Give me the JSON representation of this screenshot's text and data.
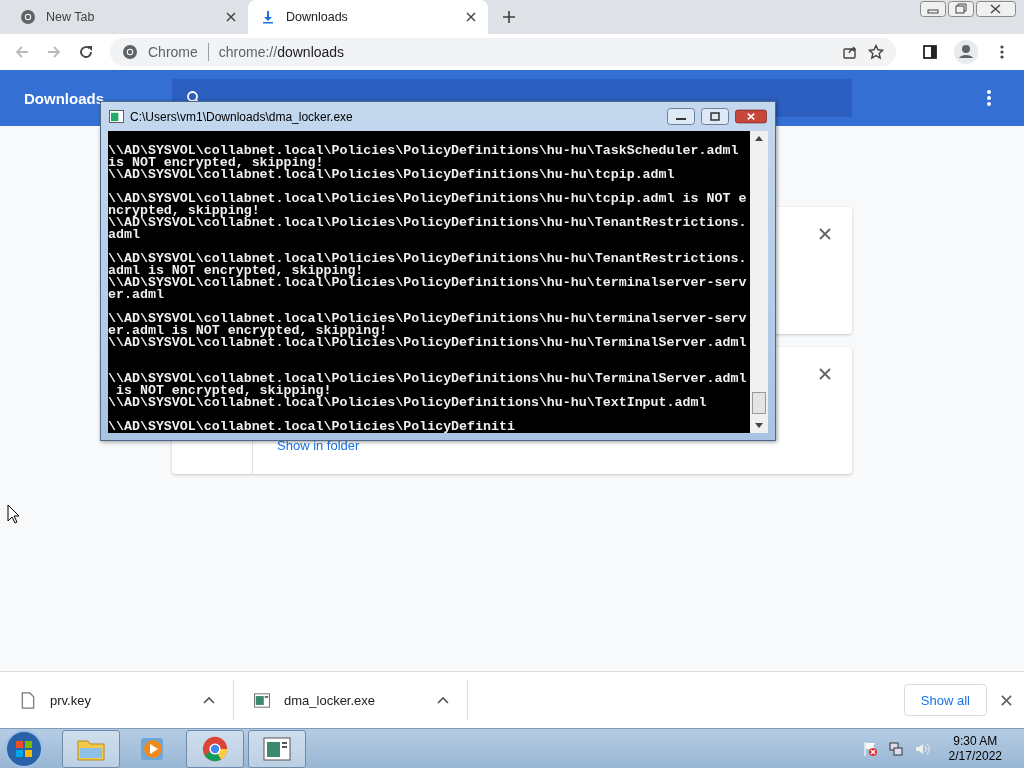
{
  "browser": {
    "tabs": [
      {
        "title": "New Tab",
        "selected": false
      },
      {
        "title": "Downloads",
        "selected": true
      }
    ],
    "omnibox": {
      "site_label": "Chrome",
      "url_prefix": "chrome://",
      "url_path": "downloads"
    }
  },
  "page": {
    "title": "Downloads",
    "cards": [
      {
        "closable": true
      },
      {
        "closable": true,
        "link": "Show in folder"
      }
    ]
  },
  "console": {
    "title": "C:\\Users\\vm1\\Downloads\\dma_locker.exe",
    "paragraphs": [
      {
        "lines": [
          "\\\\AD\\SYSVOL\\collabnet.local\\Policies\\PolicyDefinitions\\hu-hu\\TaskScheduler.adml",
          "is NOT encrypted, skipping!",
          "\\\\AD\\SYSVOL\\collabnet.local\\Policies\\PolicyDefinitions\\hu-hu\\tcpip.adml"
        ]
      },
      {
        "lines": [
          "\\\\AD\\SYSVOL\\collabnet.local\\Policies\\PolicyDefinitions\\hu-hu\\tcpip.adml is NOT e",
          "ncrypted, skipping!",
          "\\\\AD\\SYSVOL\\collabnet.local\\Policies\\PolicyDefinitions\\hu-hu\\TenantRestrictions.",
          "adml"
        ]
      },
      {
        "lines": [
          "\\\\AD\\SYSVOL\\collabnet.local\\Policies\\PolicyDefinitions\\hu-hu\\TenantRestrictions.",
          "adml is NOT encrypted, skipping!",
          "\\\\AD\\SYSVOL\\collabnet.local\\Policies\\PolicyDefinitions\\hu-hu\\terminalserver-serv",
          "er.adml"
        ]
      },
      {
        "lines": [
          "\\\\AD\\SYSVOL\\collabnet.local\\Policies\\PolicyDefinitions\\hu-hu\\terminalserver-serv",
          "er.adml is NOT encrypted, skipping!",
          "\\\\AD\\SYSVOL\\collabnet.local\\Policies\\PolicyDefinitions\\hu-hu\\TerminalServer.adml"
        ]
      },
      {
        "lines": [
          "\\\\AD\\SYSVOL\\collabnet.local\\Policies\\PolicyDefinitions\\hu-hu\\TerminalServer.adml",
          " is NOT encrypted, skipping!",
          "\\\\AD\\SYSVOL\\collabnet.local\\Policies\\PolicyDefinitions\\hu-hu\\TextInput.adml"
        ]
      },
      {
        "lines": [
          "\\\\AD\\SYSVOL\\collabnet.local\\Policies\\PolicyDefiniti"
        ]
      }
    ]
  },
  "download_shelf": {
    "items": [
      {
        "name": "prv.key"
      },
      {
        "name": "dma_locker.exe"
      }
    ],
    "show_all": "Show all"
  },
  "taskbar": {
    "apps": [
      {
        "running": true
      },
      {
        "running": false
      },
      {
        "running": true
      },
      {
        "running": true
      }
    ],
    "clock": {
      "time": "9:30 AM",
      "date": "2/17/2022"
    }
  }
}
